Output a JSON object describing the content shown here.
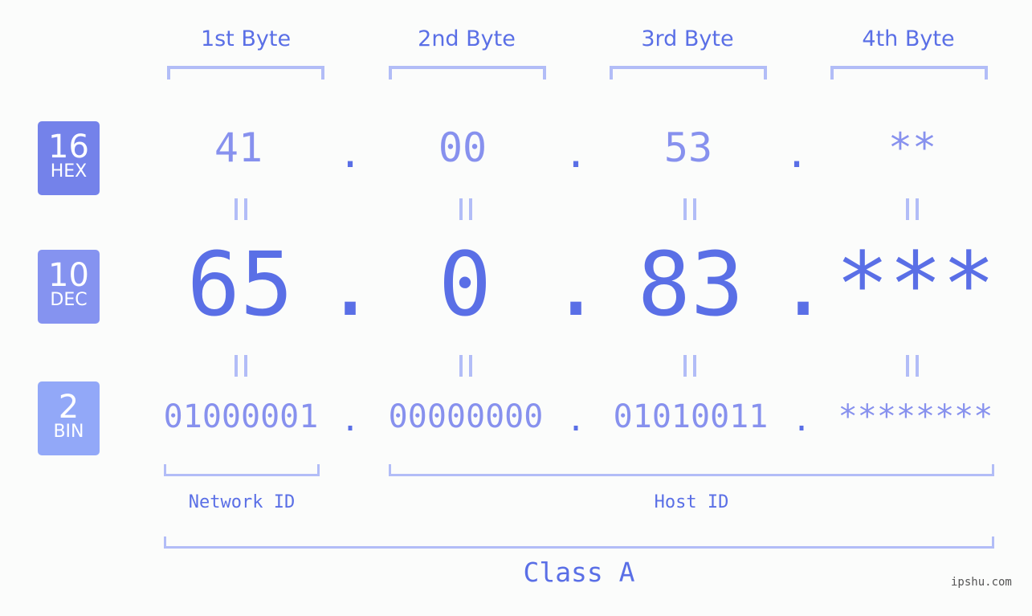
{
  "bytes": [
    {
      "header": "1st Byte",
      "hex": "41",
      "dec": "65",
      "bin": "01000001"
    },
    {
      "header": "2nd Byte",
      "hex": "00",
      "dec": "0",
      "bin": "00000000"
    },
    {
      "header": "3rd Byte",
      "hex": "53",
      "dec": "83",
      "bin": "01010011"
    },
    {
      "header": "4th Byte",
      "hex": "**",
      "dec": "***",
      "bin": "********"
    }
  ],
  "separator": ".",
  "equals_sign": "=",
  "badges": {
    "hex": {
      "number": "16",
      "label": "HEX",
      "color": "#7482ea"
    },
    "dec": {
      "number": "10",
      "label": "DEC",
      "color": "#8593f0"
    },
    "bin": {
      "number": "2",
      "label": "BIN",
      "color": "#92a8f8"
    }
  },
  "labels": {
    "network_id": "Network ID",
    "host_id": "Host ID",
    "class": "Class A"
  },
  "watermark": "ipshu.com",
  "colors": {
    "primary": "#5a6fe6",
    "secondary": "#8791ee",
    "bracket": "#b2bdf7",
    "background": "#fbfcfb"
  }
}
